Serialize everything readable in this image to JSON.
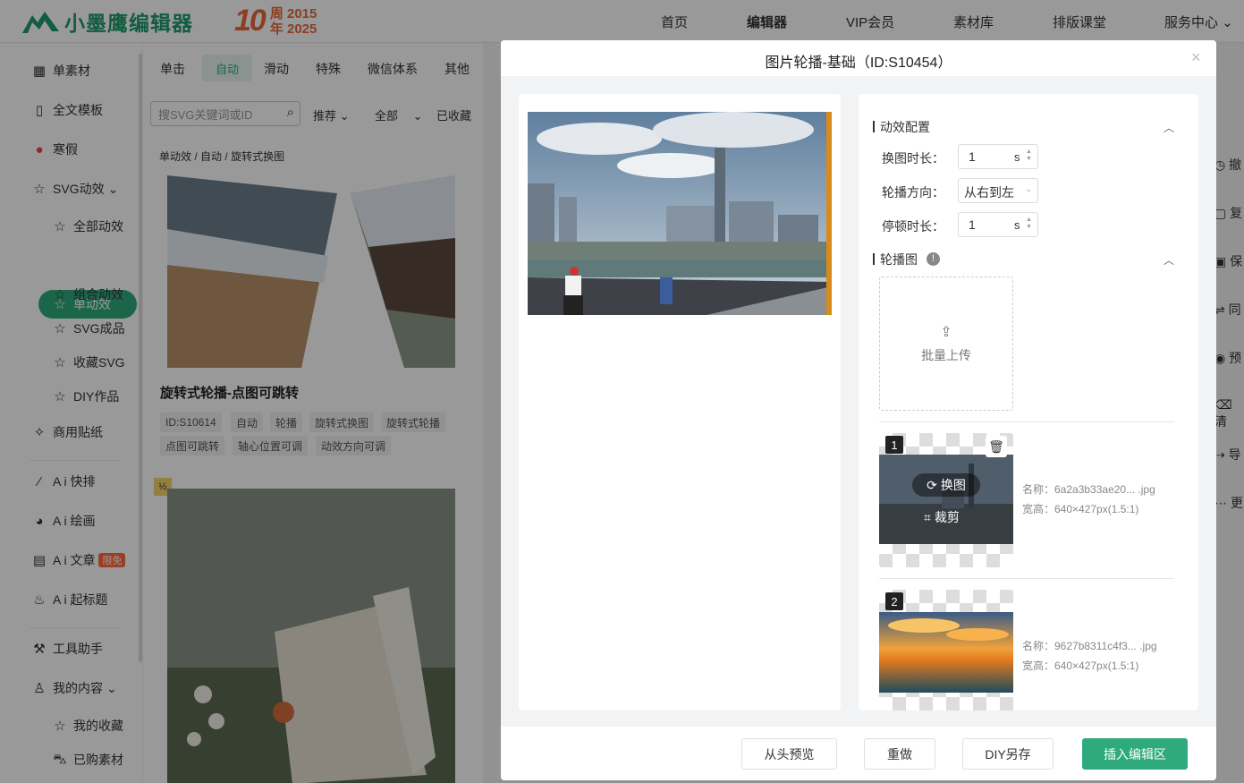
{
  "brand": {
    "logo_text": "小墨鹰编辑器",
    "anniv_big": "10",
    "anniv_line1": "周 2015",
    "anniv_line2": "年 2025",
    "accent": "#2eaa7d",
    "orange": "#e8683a"
  },
  "nav": [
    "首页",
    "编辑器",
    "VIP会员",
    "素材库",
    "排版课堂",
    "服务中心"
  ],
  "sidebar": {
    "items": [
      {
        "label": "单素材",
        "icon": "grid-icon"
      },
      {
        "label": "全文模板",
        "icon": "template-icon"
      },
      {
        "label": "寒假",
        "icon": "snow-icon"
      },
      {
        "label": "SVG动效",
        "icon": "star-icon"
      },
      {
        "label": "全部动效",
        "icon": "star-icon"
      },
      {
        "label": "单动效",
        "icon": "star-icon"
      },
      {
        "label": "组合动效",
        "icon": "star-icon"
      },
      {
        "label": "SVG成品",
        "icon": "star-icon"
      },
      {
        "label": "收藏SVG",
        "icon": "star-icon"
      },
      {
        "label": "DIY作品",
        "icon": "star-icon"
      },
      {
        "label": "商用贴纸",
        "icon": "puzzle-icon"
      },
      {
        "label": "A i 快排",
        "icon": "ai-icon"
      },
      {
        "label": "A i 绘画",
        "icon": "palette-icon"
      },
      {
        "label": "A i 文章",
        "icon": "doc-icon"
      },
      {
        "label": "A i 起标题",
        "icon": "fire-icon"
      },
      {
        "label": "工具助手",
        "icon": "tool-icon"
      },
      {
        "label": "我的内容",
        "icon": "user-icon"
      },
      {
        "label": "我的收藏",
        "icon": "star-icon"
      },
      {
        "label": "已购素材",
        "icon": "cart-icon"
      }
    ],
    "badge": "限免"
  },
  "middle": {
    "tabs": [
      "单击",
      "自动",
      "滑动",
      "特殊",
      "微信体系",
      "其他"
    ],
    "search_placeholder": "搜SVG关键词或ID",
    "filters": [
      "推荐",
      "全部",
      "已收藏"
    ],
    "breadcrumb": [
      "单动效",
      "自动",
      "旋转式换图"
    ],
    "card_title": "旋转式轮播-点图可跳转",
    "card_tags": [
      "ID:S10614",
      "自动",
      "轮播",
      "旋转式换图",
      "旋转式轮播",
      "点图可跳转",
      "轴心位置可调",
      "动效方向可调"
    ],
    "card_badge": "½"
  },
  "right_edge": [
    "撤",
    "复",
    "保",
    "同",
    "预",
    "清",
    "导",
    "更"
  ],
  "modal": {
    "title": "图片轮播-基础（ID:S10454）",
    "close": "×",
    "section_anim": "动效配置",
    "fields": {
      "switch_duration_label": "换图时长：",
      "switch_duration_value": "1",
      "direction_label": "轮播方向：",
      "direction_value": "从右到左",
      "pause_label": "停顿时长：",
      "pause_value": "1",
      "unit": "s"
    },
    "section_images": "轮播图",
    "upload_label": "批量上传",
    "images": [
      {
        "index": "1",
        "name": "名称：6a2a3b33ae20... .jpg",
        "size": "宽高：640×427px(1.5:1)",
        "replace": "换图",
        "crop": "裁剪"
      },
      {
        "index": "2",
        "name": "名称：9627b8311c4f3... .jpg",
        "size": "宽高：640×427px(1.5:1)"
      }
    ],
    "footer": {
      "preview": "从头预览",
      "redo": "重做",
      "diy_save": "DIY另存",
      "insert": "插入编辑区"
    }
  }
}
